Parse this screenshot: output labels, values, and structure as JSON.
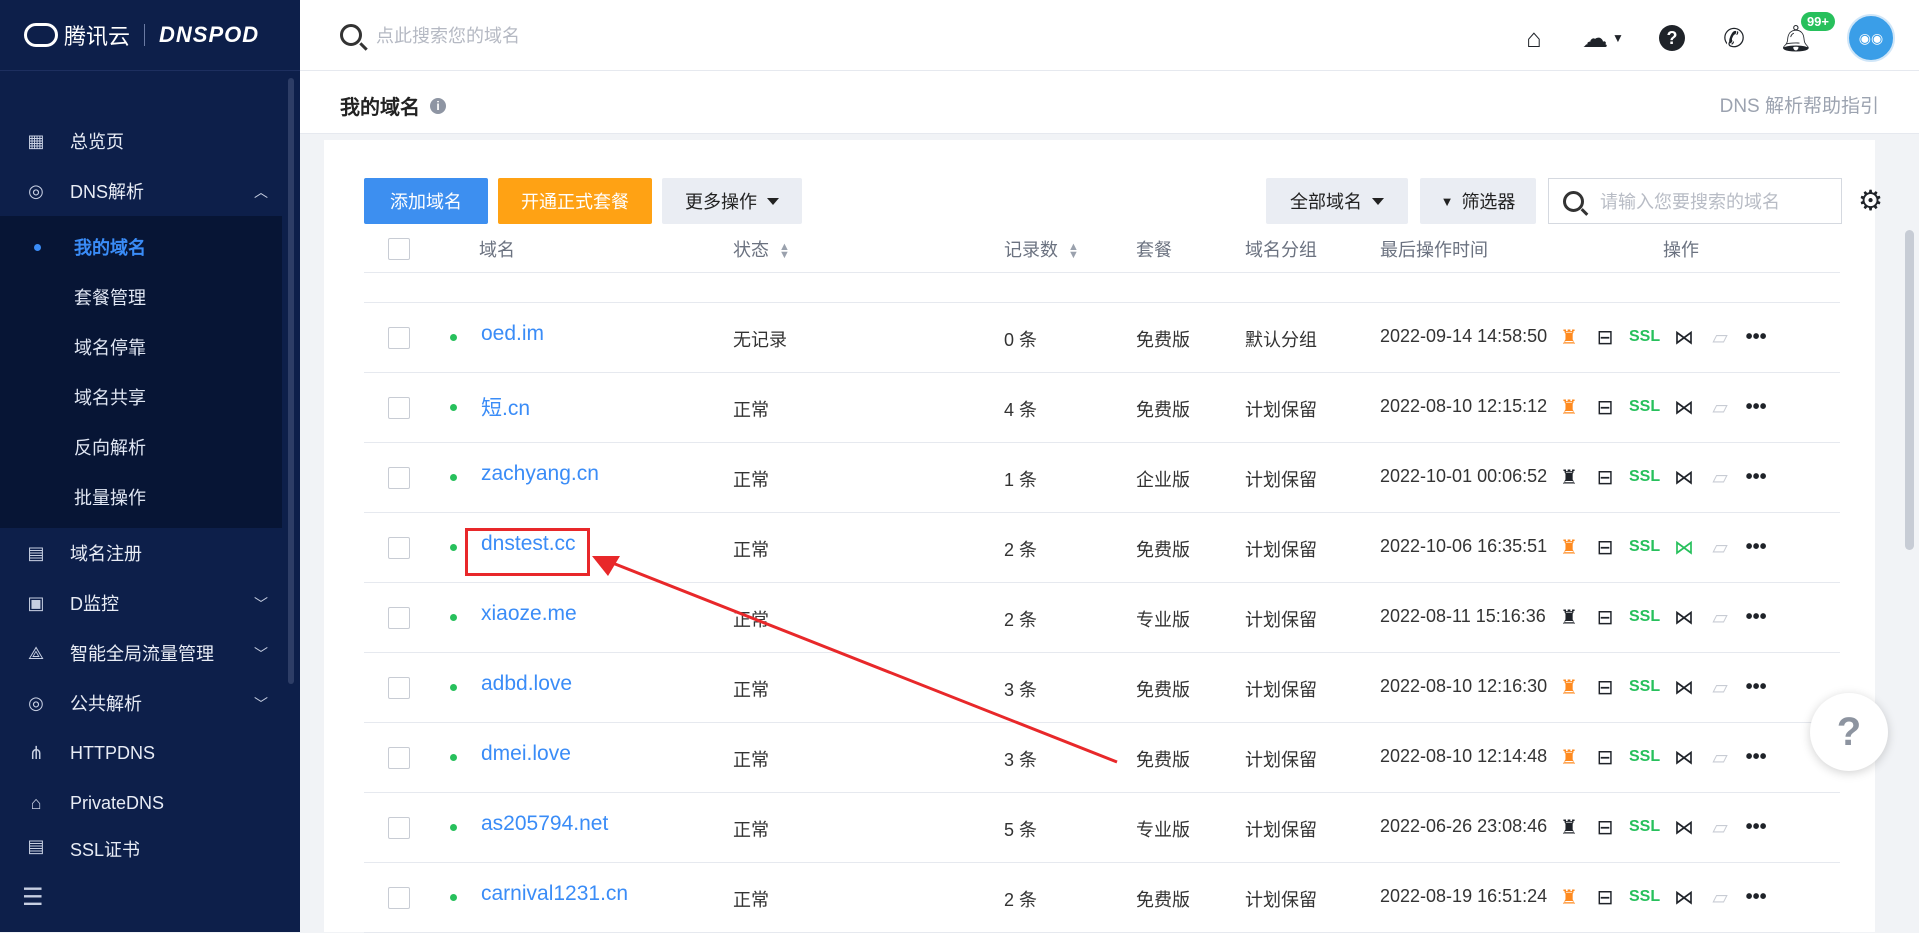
{
  "brand": {
    "tencent": "腾讯云",
    "dnspod": "DNSPOD"
  },
  "sidebar": {
    "items_top": [
      {
        "label": "总览页",
        "icon": "dashboard-icon"
      },
      {
        "label": "DNS解析",
        "icon": "globe-icon",
        "expanded": true
      }
    ],
    "sub_items": [
      {
        "label": "我的域名",
        "active": true
      },
      {
        "label": "套餐管理"
      },
      {
        "label": "域名停靠"
      },
      {
        "label": "域名共享"
      },
      {
        "label": "反向解析"
      },
      {
        "label": "批量操作"
      }
    ],
    "items_bottom": [
      {
        "label": "域名注册",
        "icon": "calendar-icon"
      },
      {
        "label": "D监控",
        "icon": "monitor-icon"
      },
      {
        "label": "智能全局流量管理",
        "icon": "network-icon"
      },
      {
        "label": "公共解析",
        "icon": "globe-icon"
      },
      {
        "label": "HTTPDNS",
        "icon": "nodes-icon"
      },
      {
        "label": "PrivateDNS",
        "icon": "lock-box-icon"
      },
      {
        "label": "SSL证书",
        "icon": "certificate-icon"
      }
    ]
  },
  "header": {
    "search_placeholder": "点此搜索您的域名",
    "notification_badge": "99+"
  },
  "page": {
    "title": "我的域名",
    "help_link": "DNS 解析帮助指引"
  },
  "toolbar": {
    "add_domain": "添加域名",
    "open_package": "开通正式套餐",
    "more_actions": "更多操作",
    "all_domains": "全部域名",
    "filter": "筛选器",
    "search_placeholder": "请输入您要搜索的域名"
  },
  "table": {
    "columns": {
      "domain": "域名",
      "status": "状态",
      "records": "记录数",
      "package": "套餐",
      "group": "域名分组",
      "last_op": "最后操作时间",
      "actions": "操作"
    },
    "ssl_label": "SSL",
    "rows": [
      {
        "domain": "oed.im",
        "status": "无记录",
        "records": "0 条",
        "package": "免费版",
        "group": "默认分组",
        "last_op": "2022-09-14 14:58:50",
        "rocket_active": true,
        "dns_green": false
      },
      {
        "domain": "短.cn",
        "status": "正常",
        "records": "4 条",
        "package": "免费版",
        "group": "计划保留",
        "last_op": "2022-08-10 12:15:12",
        "rocket_active": true,
        "dns_green": false
      },
      {
        "domain": "zachyang.cn",
        "status": "正常",
        "records": "1 条",
        "package": "企业版",
        "group": "计划保留",
        "last_op": "2022-10-01 00:06:52",
        "rocket_active": false,
        "dns_green": false
      },
      {
        "domain": "dnstest.cc",
        "status": "正常",
        "records": "2 条",
        "package": "免费版",
        "group": "计划保留",
        "last_op": "2022-10-06 16:35:51",
        "rocket_active": true,
        "dns_green": true
      },
      {
        "domain": "xiaoze.me",
        "status": "正常",
        "records": "2 条",
        "package": "专业版",
        "group": "计划保留",
        "last_op": "2022-08-11 15:16:36",
        "rocket_active": false,
        "dns_green": false
      },
      {
        "domain": "adbd.love",
        "status": "正常",
        "records": "3 条",
        "package": "免费版",
        "group": "计划保留",
        "last_op": "2022-08-10 12:16:30",
        "rocket_active": true,
        "dns_green": false
      },
      {
        "domain": "dmei.love",
        "status": "正常",
        "records": "3 条",
        "package": "免费版",
        "group": "计划保留",
        "last_op": "2022-08-10 12:14:48",
        "rocket_active": true,
        "dns_green": false
      },
      {
        "domain": "as205794.net",
        "status": "正常",
        "records": "5 条",
        "package": "专业版",
        "group": "计划保留",
        "last_op": "2022-06-26 23:08:46",
        "rocket_active": false,
        "dns_green": false
      },
      {
        "domain": "carnival1231.cn",
        "status": "正常",
        "records": "2 条",
        "package": "免费版",
        "group": "计划保留",
        "last_op": "2022-08-19 16:51:24",
        "rocket_active": true,
        "dns_green": false
      }
    ]
  },
  "colors": {
    "accent": "#3a8cf7",
    "sidebar": "#0d1f4a",
    "orange": "#ffa214",
    "green": "#27c05c",
    "annotation": "#e8282a"
  }
}
